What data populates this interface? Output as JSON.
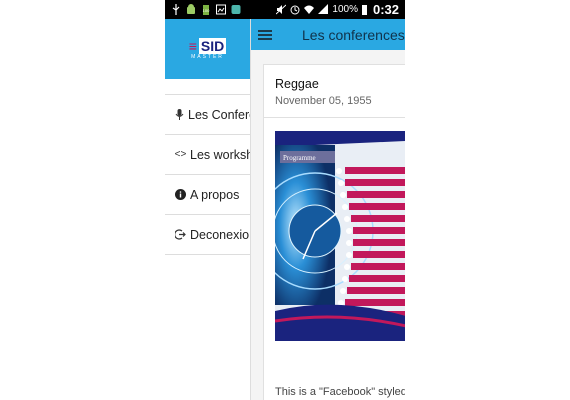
{
  "status_bar": {
    "left_icons": [
      "usb-icon",
      "android-icon",
      "battery-100-icon",
      "image-icon",
      "app-icon"
    ],
    "right_icons": [
      "mute-icon",
      "alarm-icon",
      "wifi-icon",
      "signal-icon"
    ],
    "battery": "100%",
    "time": "0:32"
  },
  "drawer": {
    "logo": {
      "main": "SID",
      "sub": "MASTER"
    },
    "items": [
      {
        "label": "Les Conferences",
        "icon": "microphone-icon"
      },
      {
        "label": "Les workshops",
        "icon": "code-icon"
      },
      {
        "label": "A propos",
        "icon": "info-icon"
      },
      {
        "label": "Deconexion",
        "icon": "logout-icon"
      }
    ]
  },
  "appbar": {
    "title": "Les conferences"
  },
  "card": {
    "title": "Reggae",
    "date": "November 05, 1955",
    "poster_label": "Programme",
    "caption": "This is a \"Facebook\" styled C"
  },
  "colors": {
    "accent": "#2aa8e2",
    "poster_pink": "#c2185b",
    "poster_navy": "#1a237e"
  }
}
